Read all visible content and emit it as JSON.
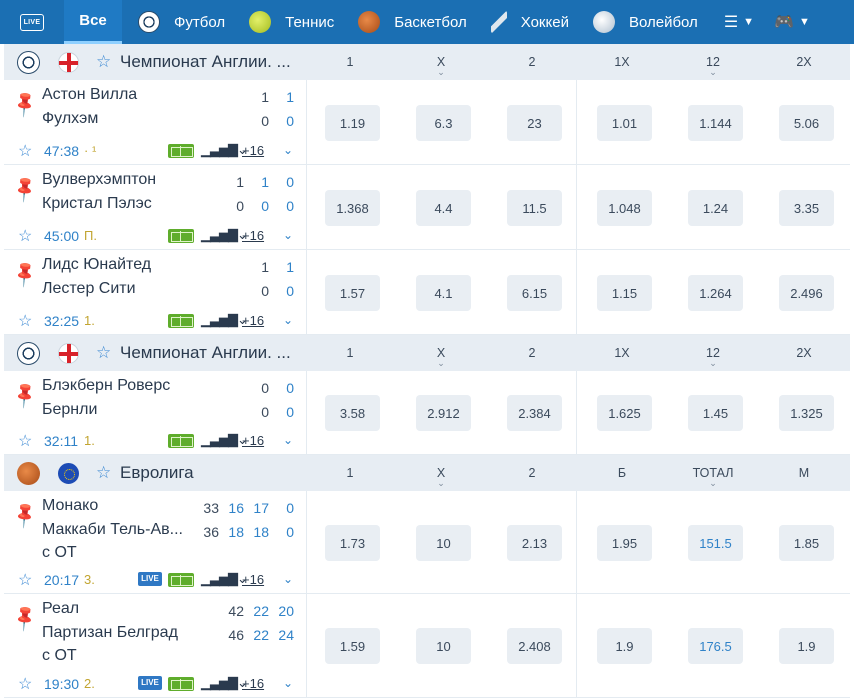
{
  "nav": {
    "live_label": "LIVE",
    "all_label": "Все",
    "tabs": [
      {
        "label": "Футбол",
        "icon": "football-icon"
      },
      {
        "label": "Теннис",
        "icon": "tennis-icon"
      },
      {
        "label": "Баскетбол",
        "icon": "basketball-icon"
      },
      {
        "label": "Хоккей",
        "icon": "hockey-icon"
      },
      {
        "label": "Волейбол",
        "icon": "volleyball-icon"
      }
    ]
  },
  "leagues": [
    {
      "name": "Чемпионат Англии. ...",
      "sport_icon": "football-icon",
      "flag_icon": "england-flag-icon",
      "columns": [
        "1",
        "X",
        "2",
        "1X",
        "12",
        "2X"
      ],
      "matches": [
        {
          "team1": "Астон Вилла",
          "team2": "Фулхэм",
          "extra": "",
          "scores1": [
            "1",
            "1"
          ],
          "scores2": [
            "0",
            "0"
          ],
          "time": "47:38",
          "period": "· ¹",
          "live": false,
          "more": "+16",
          "odds": [
            "1.19",
            "6.3",
            "23",
            "1.01",
            "1.144",
            "5.06"
          ]
        },
        {
          "team1": "Вулверхэмптон",
          "team2": "Кристал Пэлэс",
          "extra": "",
          "scores1": [
            "1",
            "1",
            "0"
          ],
          "scores2": [
            "0",
            "0",
            "0"
          ],
          "time": "45:00",
          "period": "П.",
          "live": false,
          "more": "+16",
          "odds": [
            "1.368",
            "4.4",
            "11.5",
            "1.048",
            "1.24",
            "3.35"
          ]
        },
        {
          "team1": "Лидс Юнайтед",
          "team2": "Лестер Сити",
          "extra": "",
          "scores1": [
            "1",
            "1"
          ],
          "scores2": [
            "0",
            "0"
          ],
          "time": "32:25",
          "period": "1.",
          "live": false,
          "more": "+16",
          "odds": [
            "1.57",
            "4.1",
            "6.15",
            "1.15",
            "1.264",
            "2.496"
          ]
        }
      ]
    },
    {
      "name": "Чемпионат Англии. ...",
      "sport_icon": "football-icon",
      "flag_icon": "england-flag-icon",
      "columns": [
        "1",
        "X",
        "2",
        "1X",
        "12",
        "2X"
      ],
      "matches": [
        {
          "team1": "Блэкберн Роверс",
          "team2": "Бернли",
          "extra": "",
          "scores1": [
            "0",
            "0"
          ],
          "scores2": [
            "0",
            "0"
          ],
          "time": "32:11",
          "period": "1.",
          "live": false,
          "more": "+16",
          "odds": [
            "3.58",
            "2.912",
            "2.384",
            "1.625",
            "1.45",
            "1.325"
          ]
        }
      ]
    },
    {
      "name": "Евролига",
      "sport_icon": "basketball-icon",
      "flag_icon": "eu-flag-icon",
      "columns": [
        "1",
        "X",
        "2",
        "Б",
        "ТОТАЛ",
        "М"
      ],
      "matches": [
        {
          "team1": "Монако",
          "team2": "Маккаби Тель-Ав...",
          "extra": "с ОТ",
          "scores1": [
            "33",
            "16",
            "17",
            "0"
          ],
          "scores2": [
            "36",
            "18",
            "18",
            "0"
          ],
          "time": "20:17",
          "period": "3.",
          "live": true,
          "more": "+16",
          "odds": [
            "1.73",
            "10",
            "2.13",
            "1.95",
            "151.5",
            "1.85"
          ]
        },
        {
          "team1": "Реал",
          "team2": "Партизан Белград",
          "extra": "с ОТ",
          "scores1": [
            "42",
            "22",
            "20"
          ],
          "scores2": [
            "46",
            "22",
            "24"
          ],
          "time": "19:30",
          "period": "2.",
          "live": true,
          "more": "+16",
          "odds": [
            "1.59",
            "10",
            "2.408",
            "1.9",
            "176.5",
            "1.9"
          ]
        }
      ]
    }
  ],
  "live_badge": "LIVE",
  "colors": {
    "nav_bg": "#1b6fb3",
    "accent": "#2f82c8",
    "league_bg": "#e7edf3",
    "odd_bg": "#e9eef3",
    "period": "#c2a531"
  }
}
